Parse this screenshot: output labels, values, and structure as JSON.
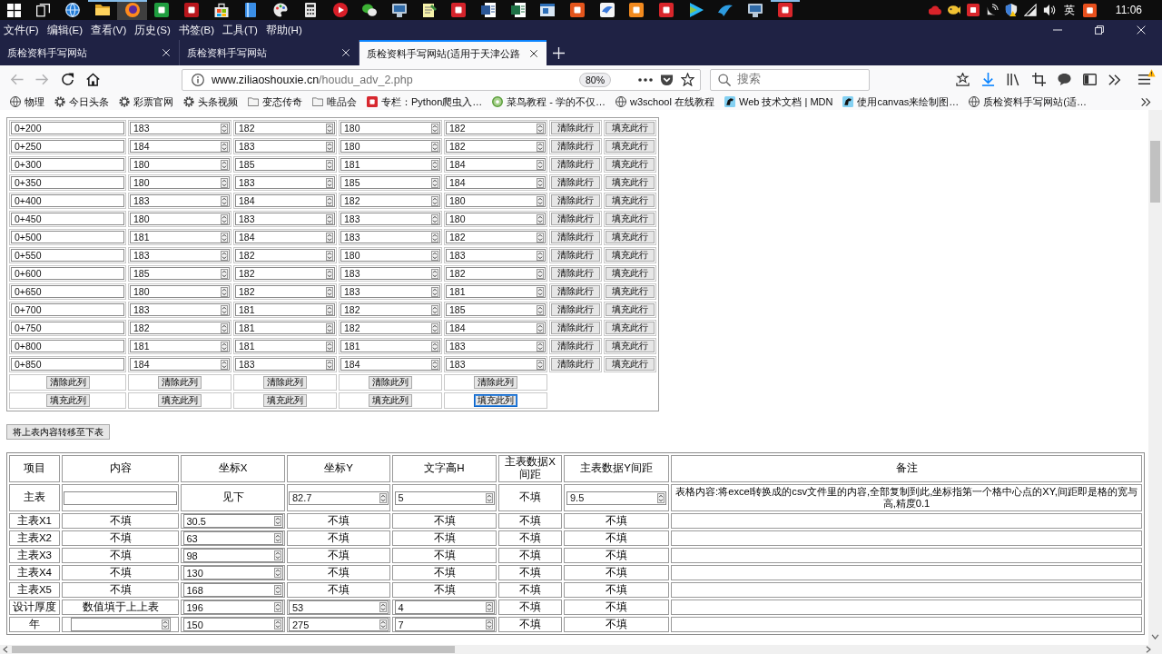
{
  "taskbar": {
    "apps": [
      {
        "running": false,
        "selected": false
      },
      {
        "running": true,
        "selected": false
      },
      {
        "running": true,
        "selected": true
      },
      {
        "running": false,
        "selected": false
      },
      {
        "running": false,
        "selected": false
      },
      {
        "running": false,
        "selected": false
      },
      {
        "running": false,
        "selected": false
      },
      {
        "running": false,
        "selected": false
      },
      {
        "running": false,
        "selected": false
      },
      {
        "running": false,
        "selected": false
      },
      {
        "running": false,
        "selected": false
      },
      {
        "running": false,
        "selected": false
      },
      {
        "running": false,
        "selected": false
      },
      {
        "running": false,
        "selected": false
      },
      {
        "running": false,
        "selected": false
      },
      {
        "running": false,
        "selected": false
      },
      {
        "running": false,
        "selected": false
      },
      {
        "running": false,
        "selected": false
      },
      {
        "running": false,
        "selected": false
      },
      {
        "running": false,
        "selected": false
      },
      {
        "running": false,
        "selected": false
      },
      {
        "running": false,
        "selected": false
      },
      {
        "running": false,
        "selected": false
      },
      {
        "running": false,
        "selected": false
      },
      {
        "running": true,
        "selected": false
      }
    ],
    "input_method": "英",
    "clock": "11:06"
  },
  "menu_bar": [
    "文件(F)",
    "编辑(E)",
    "查看(V)",
    "历史(S)",
    "书签(B)",
    "工具(T)",
    "帮助(H)"
  ],
  "tabs": [
    {
      "title": "质检资料手写网站",
      "selected": false
    },
    {
      "title": "质检资料手写网站",
      "selected": false
    },
    {
      "title": "质检资料手写网站(适用于天津公路",
      "selected": true
    }
  ],
  "toolbar": {
    "back": {
      "disabled": true
    },
    "forward": {
      "disabled": true
    },
    "url": {
      "host": "www.ziliaoshouxie.cn",
      "path": "/houdu_adv_2.php"
    },
    "zoom": "80%",
    "search": {
      "placeholder": "搜索"
    },
    "menu_alert": true
  },
  "bookmarks": [
    {
      "kind": "page",
      "label": "物理"
    },
    {
      "kind": "page",
      "label": "今日头条"
    },
    {
      "kind": "page",
      "label": "彩票官网"
    },
    {
      "kind": "page",
      "label": "头条视频"
    },
    {
      "kind": "folder",
      "label": "变态传奇"
    },
    {
      "kind": "folder",
      "label": "唯品会"
    },
    {
      "kind": "page",
      "label": "专栏：Python爬虫入…"
    },
    {
      "kind": "page",
      "label": "菜鸟教程 - 学的不仅…"
    },
    {
      "kind": "page",
      "label": "w3school 在线教程"
    },
    {
      "kind": "page",
      "label": "Web 技术文档 | MDN"
    },
    {
      "kind": "page",
      "label": "使用canvas来绘制图…"
    },
    {
      "kind": "page",
      "label": "质检资料手写网站(适…"
    }
  ],
  "upper_table": {
    "rows": [
      {
        "station": "0+200",
        "values": [
          "183",
          "182",
          "180",
          "182"
        ],
        "clear_button": "清除此行",
        "fill_button": "填充此行"
      },
      {
        "station": "0+250",
        "values": [
          "184",
          "183",
          "180",
          "182"
        ],
        "clear_button": "清除此行",
        "fill_button": "填充此行"
      },
      {
        "station": "0+300",
        "values": [
          "180",
          "185",
          "181",
          "184"
        ],
        "clear_button": "清除此行",
        "fill_button": "填充此行"
      },
      {
        "station": "0+350",
        "values": [
          "180",
          "183",
          "185",
          "184"
        ],
        "clear_button": "清除此行",
        "fill_button": "填充此行"
      },
      {
        "station": "0+400",
        "values": [
          "183",
          "184",
          "182",
          "180"
        ],
        "clear_button": "清除此行",
        "fill_button": "填充此行"
      },
      {
        "station": "0+450",
        "values": [
          "180",
          "183",
          "183",
          "180"
        ],
        "clear_button": "清除此行",
        "fill_button": "填充此行"
      },
      {
        "station": "0+500",
        "values": [
          "181",
          "184",
          "183",
          "182"
        ],
        "clear_button": "清除此行",
        "fill_button": "填充此行"
      },
      {
        "station": "0+550",
        "values": [
          "183",
          "182",
          "180",
          "183"
        ],
        "clear_button": "清除此行",
        "fill_button": "填充此行"
      },
      {
        "station": "0+600",
        "values": [
          "185",
          "182",
          "183",
          "182"
        ],
        "clear_button": "清除此行",
        "fill_button": "填充此行"
      },
      {
        "station": "0+650",
        "values": [
          "180",
          "182",
          "183",
          "181"
        ],
        "clear_button": "清除此行",
        "fill_button": "填充此行"
      },
      {
        "station": "0+700",
        "values": [
          "183",
          "181",
          "182",
          "185"
        ],
        "clear_button": "清除此行",
        "fill_button": "填充此行"
      },
      {
        "station": "0+750",
        "values": [
          "182",
          "181",
          "182",
          "184"
        ],
        "clear_button": "清除此行",
        "fill_button": "填充此行"
      },
      {
        "station": "0+800",
        "values": [
          "181",
          "181",
          "181",
          "183"
        ],
        "clear_button": "清除此行",
        "fill_button": "填充此行"
      },
      {
        "station": "0+850",
        "values": [
          "184",
          "183",
          "184",
          "183"
        ],
        "clear_button": "清除此行",
        "fill_button": "填充此行"
      }
    ],
    "clear_column_buttons": [
      {
        "label": "清除此列"
      },
      {
        "label": "清除此列"
      },
      {
        "label": "清除此列"
      },
      {
        "label": "清除此列"
      },
      {
        "label": "清除此列"
      }
    ],
    "fill_column_buttons": [
      {
        "label": "填充此列",
        "focused": false
      },
      {
        "label": "填充此列",
        "focused": false
      },
      {
        "label": "填充此列",
        "focused": false
      },
      {
        "label": "填充此列",
        "focused": false
      },
      {
        "label": "填充此列",
        "focused": true
      }
    ]
  },
  "transfer_button": "将上表内容转移至下表",
  "lower_table": {
    "columns": [
      "项目",
      "内容",
      "坐标X",
      "坐标Y",
      "文字高H",
      "主表数据X间距",
      "主表数据Y间距",
      "备注"
    ],
    "rows": [
      {
        "cells": [
          {
            "kind": "label",
            "text": "主表"
          },
          {
            "kind": "text_field"
          },
          {
            "kind": "text",
            "text": "见下"
          },
          {
            "kind": "number_field",
            "value": "82.7"
          },
          {
            "kind": "number_field",
            "value": "5"
          },
          {
            "kind": "text",
            "text": "不填"
          },
          {
            "kind": "number_field",
            "value": "9.5"
          },
          {
            "kind": "text",
            "text": "表格内容:将excel转换成的csv文件里的内容,全部复制到此,坐标指第一个格中心点的XY,间距即是格的宽与高,精度0.1"
          }
        ]
      },
      {
        "cells": [
          {
            "kind": "label",
            "text": "主表X1"
          },
          {
            "kind": "text",
            "text": "不填"
          },
          {
            "kind": "number_field",
            "value": "30.5"
          },
          {
            "kind": "text",
            "text": "不填"
          },
          {
            "kind": "text",
            "text": "不填"
          },
          {
            "kind": "text",
            "text": "不填"
          },
          {
            "kind": "text",
            "text": "不填"
          }
        ]
      },
      {
        "cells": [
          {
            "kind": "label",
            "text": "主表X2"
          },
          {
            "kind": "text",
            "text": "不填"
          },
          {
            "kind": "number_field",
            "value": "63"
          },
          {
            "kind": "text",
            "text": "不填"
          },
          {
            "kind": "text",
            "text": "不填"
          },
          {
            "kind": "text",
            "text": "不填"
          },
          {
            "kind": "text",
            "text": "不填"
          }
        ]
      },
      {
        "cells": [
          {
            "kind": "label",
            "text": "主表X3"
          },
          {
            "kind": "text",
            "text": "不填"
          },
          {
            "kind": "number_field",
            "value": "98"
          },
          {
            "kind": "text",
            "text": "不填"
          },
          {
            "kind": "text",
            "text": "不填"
          },
          {
            "kind": "text",
            "text": "不填"
          },
          {
            "kind": "text",
            "text": "不填"
          }
        ]
      },
      {
        "cells": [
          {
            "kind": "label",
            "text": "主表X4"
          },
          {
            "kind": "text",
            "text": "不填"
          },
          {
            "kind": "number_field",
            "value": "130"
          },
          {
            "kind": "text",
            "text": "不填"
          },
          {
            "kind": "text",
            "text": "不填"
          },
          {
            "kind": "text",
            "text": "不填"
          },
          {
            "kind": "text",
            "text": "不填"
          }
        ]
      },
      {
        "cells": [
          {
            "kind": "label",
            "text": "主表X5"
          },
          {
            "kind": "text",
            "text": "不填"
          },
          {
            "kind": "number_field",
            "value": "168"
          },
          {
            "kind": "text",
            "text": "不填"
          },
          {
            "kind": "text",
            "text": "不填"
          },
          {
            "kind": "text",
            "text": "不填"
          },
          {
            "kind": "text",
            "text": "不填"
          }
        ]
      },
      {
        "cells": [
          {
            "kind": "label",
            "text": "设计厚度"
          },
          {
            "kind": "text",
            "text": "数值填于上上表"
          },
          {
            "kind": "number_field",
            "value": "196"
          },
          {
            "kind": "number_field",
            "value": "53"
          },
          {
            "kind": "number_field",
            "value": "4"
          },
          {
            "kind": "text",
            "text": "不填"
          },
          {
            "kind": "text",
            "text": "不填"
          }
        ]
      },
      {
        "cells": [
          {
            "kind": "label",
            "text": "年"
          },
          {
            "kind": "number_field"
          },
          {
            "kind": "number_field",
            "value": "150"
          },
          {
            "kind": "number_field",
            "value": "275"
          },
          {
            "kind": "number_field",
            "value": "7"
          },
          {
            "kind": "text",
            "text": "不填"
          },
          {
            "kind": "text",
            "text": "不填"
          }
        ]
      }
    ]
  }
}
